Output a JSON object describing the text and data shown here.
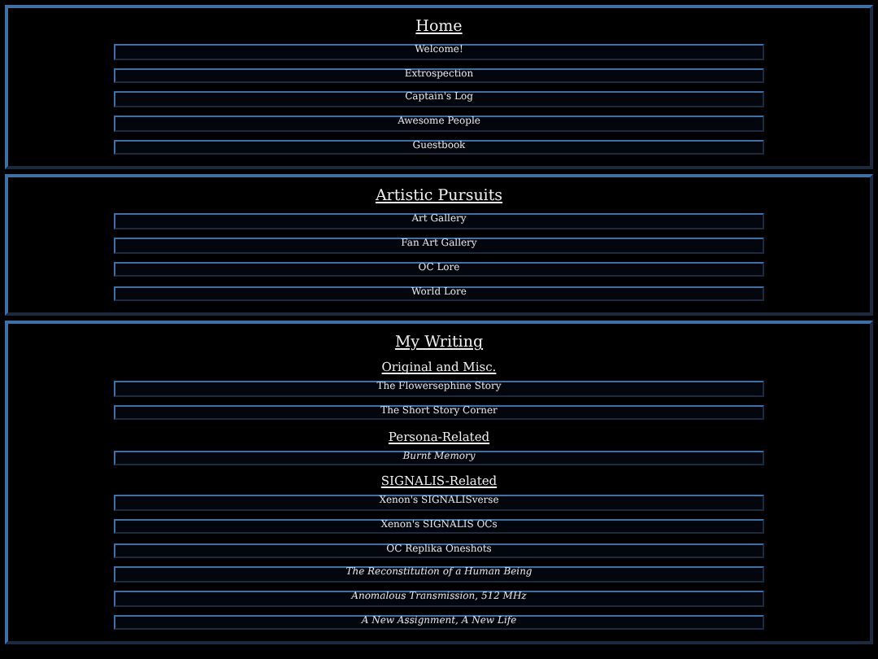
{
  "sections": [
    {
      "title": "Home",
      "groups": [
        {
          "links": [
            {
              "label": "Welcome!",
              "italic": false
            },
            {
              "label": "Extrospection",
              "italic": false
            },
            {
              "label": "Captain's Log",
              "italic": false
            },
            {
              "label": "Awesome People",
              "italic": false
            },
            {
              "label": "Guestbook",
              "italic": false
            }
          ]
        }
      ]
    },
    {
      "title": "Artistic Pursuits",
      "groups": [
        {
          "links": [
            {
              "label": "Art Gallery",
              "italic": false
            },
            {
              "label": "Fan Art Gallery",
              "italic": false
            },
            {
              "label": "OC Lore",
              "italic": false
            },
            {
              "label": "World Lore",
              "italic": false
            }
          ]
        }
      ]
    },
    {
      "title": "My Writing",
      "groups": [
        {
          "heading": "Original and Misc.",
          "links": [
            {
              "label": "The Flowersephine Story",
              "italic": false
            },
            {
              "label": "The Short Story Corner",
              "italic": false
            }
          ]
        },
        {
          "heading": "Persona-Related",
          "links": [
            {
              "label": "Burnt Memory",
              "italic": true
            }
          ]
        },
        {
          "heading": "SIGNALIS-Related",
          "links": [
            {
              "label": "Xenon's SIGNALISverse",
              "italic": false
            },
            {
              "label": "Xenon's SIGNALIS OCs",
              "italic": false
            },
            {
              "label": "OC Replika Oneshots",
              "italic": false
            },
            {
              "label": "The Reconstitution of a Human Being",
              "italic": true
            },
            {
              "label": "Anomalous Transmission, 512 MHz",
              "italic": true
            },
            {
              "label": "A New Assignment, A New Life",
              "italic": true
            }
          ]
        }
      ]
    }
  ]
}
